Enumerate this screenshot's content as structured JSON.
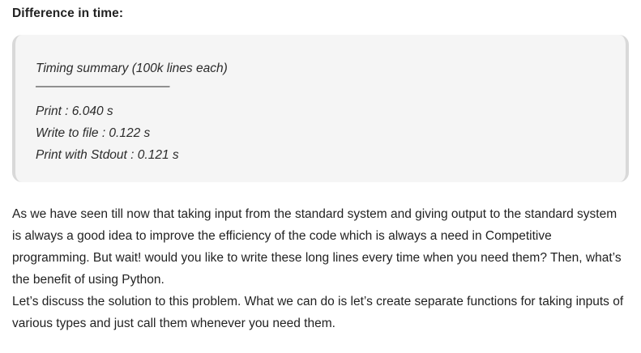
{
  "heading": "Difference in time:",
  "code_block": {
    "lines": [
      "Timing summary (100k lines each)",
      "———————————",
      "Print : 6.040 s",
      "Write to file : 0.122 s",
      "Print with Stdout : 0.121 s"
    ]
  },
  "paragraphs": [
    "As we have seen till now that taking input from the standard system and giving output to the standard system is always a good idea to improve the efficiency of the code which is always a need in Competitive programming. But wait! would you like to write these long lines every time when you need them? Then, what’s the benefit of using Python.",
    "Let’s discuss the solution to this problem. What we can do is let’s create separate functions for taking inputs of various types and just call them whenever you need them."
  ]
}
